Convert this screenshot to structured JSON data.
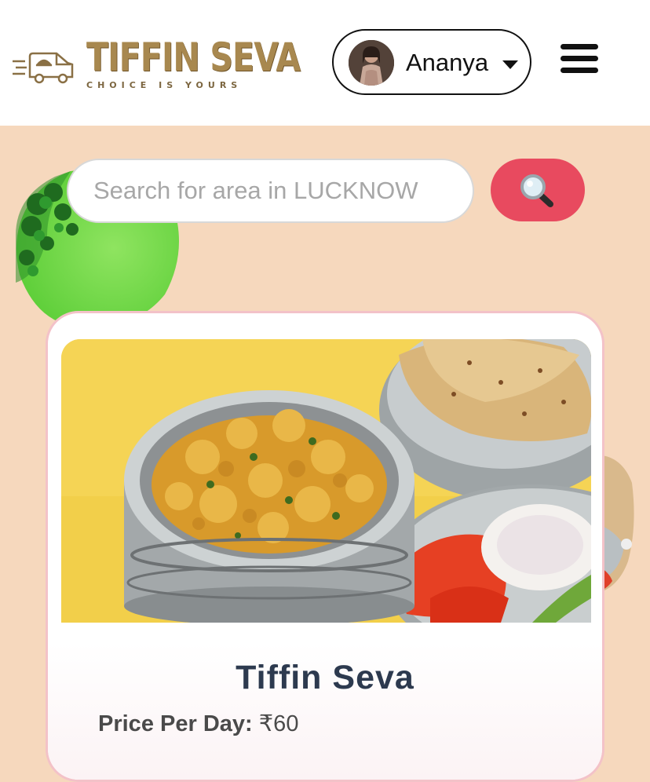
{
  "header": {
    "logo_title": "TIFFIN SEVA",
    "logo_tagline": "CHOICE IS YOURS",
    "user_name": "Ananya"
  },
  "search": {
    "placeholder": "Search for area in LUCKNOW",
    "button_icon": "magnifier-icon"
  },
  "card": {
    "title": "Tiffin Seva",
    "price_label": "Price Per Day:",
    "price_value": "₹60"
  },
  "colors": {
    "page_background": "#f6d8bd",
    "search_button": "#e84a5f",
    "card_border": "#f3c2c8",
    "title_text": "#2d3a4f",
    "logo_gold": "#a8884f"
  }
}
